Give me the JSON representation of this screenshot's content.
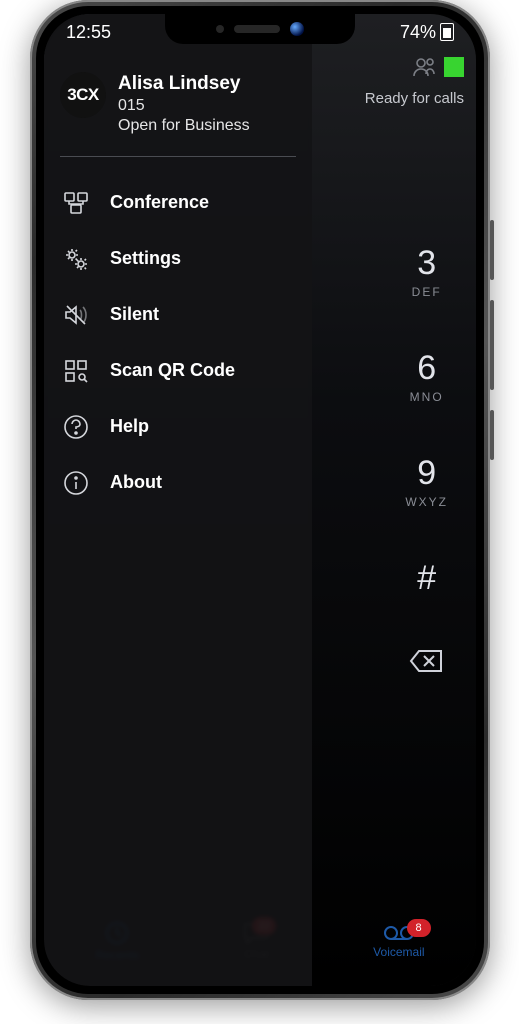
{
  "status": {
    "time": "12:55",
    "battery": "74%"
  },
  "header": {
    "ready_label": "Ready for calls"
  },
  "profile": {
    "logo_text": "3CX",
    "name": "Alisa Lindsey",
    "extension": "015",
    "status": "Open for Business"
  },
  "menu": {
    "items": [
      {
        "label": "Conference"
      },
      {
        "label": "Settings"
      },
      {
        "label": "Silent"
      },
      {
        "label": "Scan QR Code"
      },
      {
        "label": "Help"
      },
      {
        "label": "About"
      }
    ]
  },
  "dialer": {
    "keys": [
      {
        "num": "3",
        "letters": "DEF"
      },
      {
        "num": "6",
        "letters": "MNO"
      },
      {
        "num": "9",
        "letters": "WXYZ"
      },
      {
        "num": "#",
        "letters": ""
      }
    ]
  },
  "bottom_nav": {
    "items": [
      {
        "label": "Recents",
        "badge": ""
      },
      {
        "label": "Chat",
        "badge": "22"
      },
      {
        "label": "Voicemail",
        "badge": "8"
      }
    ]
  }
}
